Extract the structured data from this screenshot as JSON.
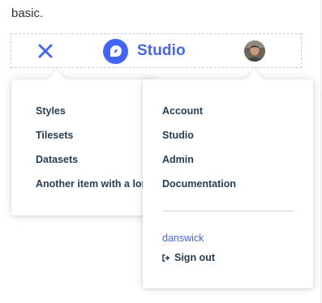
{
  "intro": {
    "text": "basic."
  },
  "header": {
    "close_icon": "close-icon",
    "brand": {
      "name": "Studio",
      "logo_icon": "studio-logo-icon",
      "color": "#4264fb"
    },
    "avatar_icon": "user-avatar"
  },
  "left_menu": {
    "items": [
      {
        "label": "Styles"
      },
      {
        "label": "Tilesets"
      },
      {
        "label": "Datasets"
      },
      {
        "label": "Another item with a long label"
      }
    ]
  },
  "right_menu": {
    "items": [
      {
        "label": "Account"
      },
      {
        "label": "Studio"
      },
      {
        "label": "Admin"
      },
      {
        "label": "Documentation"
      }
    ],
    "username": "danswick",
    "signout": {
      "label": "Sign out",
      "icon": "sign-out-icon"
    }
  }
}
